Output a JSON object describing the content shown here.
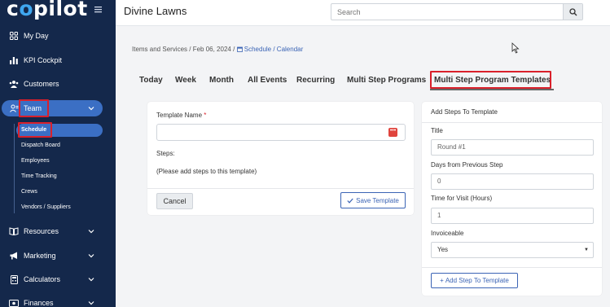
{
  "brand": {
    "logo_pre": "c",
    "logo_o": "o",
    "logo_post": "pilot"
  },
  "sidebar": {
    "items": [
      {
        "label": "My Day",
        "icon": "grid-icon"
      },
      {
        "label": "KPI Cockpit",
        "icon": "bar-chart-icon"
      },
      {
        "label": "Customers",
        "icon": "users-icon"
      },
      {
        "label": "Team",
        "icon": "team-icon"
      },
      {
        "label": "Resources",
        "icon": "book-icon"
      },
      {
        "label": "Marketing",
        "icon": "megaphone-icon"
      },
      {
        "label": "Calculators",
        "icon": "calculator-icon"
      },
      {
        "label": "Finances",
        "icon": "money-icon"
      }
    ],
    "team_sub": [
      "Schedule",
      "Dispatch Board",
      "Employees",
      "Time Tracking",
      "Crews",
      "Vendors / Suppliers"
    ]
  },
  "header": {
    "title": "Divine Lawns",
    "search_placeholder": "Search"
  },
  "breadcrumb": {
    "part1": "Items and Services / Feb 06, 2024 /",
    "link": "Schedule / Calendar"
  },
  "tabs": [
    "Today",
    "Week",
    "Month",
    "All Events",
    "Recurring",
    "Multi Step Programs",
    "Multi Step Program Templates"
  ],
  "template_form": {
    "name_label": "Template Name",
    "required_mark": "*",
    "steps_label": "Steps:",
    "empty_hint": "(Please add steps to this template)",
    "cancel": "Cancel",
    "save": "Save Template"
  },
  "add_steps": {
    "title": "Add Steps To Template",
    "title_label": "Title",
    "title_placeholder": "Round #1",
    "days_label": "Days from Previous Step",
    "days_placeholder": "0",
    "hours_label": "Time for Visit (Hours)",
    "hours_placeholder": "1",
    "invoiceable_label": "Invoiceable",
    "invoiceable_value": "Yes",
    "add_button": "Add Step To Template"
  },
  "colors": {
    "sidebar_bg": "#14284b",
    "active_pill": "#3b6fc4",
    "highlight_box": "#d9202b",
    "link": "#3b64b5"
  }
}
